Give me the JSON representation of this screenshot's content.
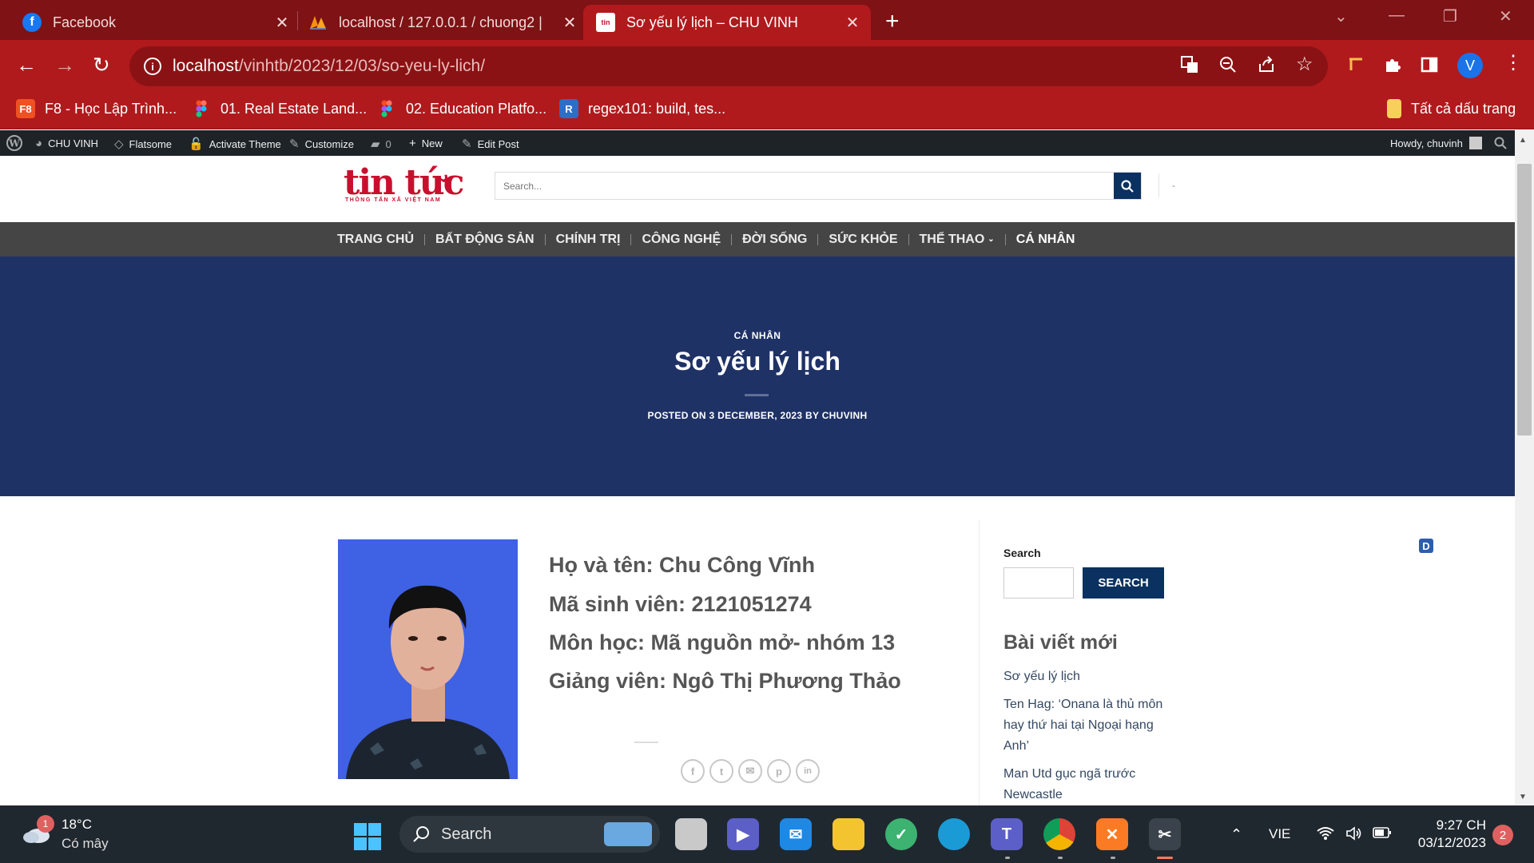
{
  "browser": {
    "tabs": [
      {
        "title": "Facebook",
        "active": false
      },
      {
        "title": "localhost / 127.0.0.1 / chuong2 |",
        "active": false
      },
      {
        "title": "Sơ yếu lý lịch – CHU VINH",
        "active": true
      }
    ],
    "new_tab_label": "+",
    "url_host": "localhost",
    "url_path": "/vinhtb/2023/12/03/so-yeu-ly-lich/",
    "profile_initial": "V",
    "bookmarks": [
      {
        "label": "F8 - Học Lập Trình...",
        "icon": "F8"
      },
      {
        "label": "01. Real Estate Land...",
        "icon": "figma-icon"
      },
      {
        "label": "02. Education Platfo...",
        "icon": "figma-icon"
      },
      {
        "label": "regex101: build, tes...",
        "icon": "R"
      }
    ],
    "all_bookmarks": "Tất cả dấu trang",
    "accent": "#b01a1d"
  },
  "adminbar": {
    "site": "CHU VINH",
    "theme": "Flatsome",
    "activate": "Activate Theme",
    "customize": "Customize",
    "comments": "0",
    "new": "New",
    "edit": "Edit Post",
    "howdy": "Howdy, chuvinh"
  },
  "site": {
    "logo": "tin tức",
    "logo_sub": "THÔNG TẤN XÃ VIỆT NAM",
    "search_placeholder": "Search...",
    "header_dash": "-",
    "nav": [
      "TRANG CHỦ",
      "BẤT ĐỘNG SẢN",
      "CHÍNH TRỊ",
      "CÔNG NGHỆ",
      "ĐỜI SỐNG",
      "SỨC KHỎE",
      "THỂ THAO",
      "CÁ NHÂN"
    ],
    "nav_dropdown_index": 6,
    "hero_bg": "#1f3266",
    "category": "CÁ NHÂN",
    "post_title": "Sơ yếu lý lịch",
    "meta": "POSTED ON 3 DECEMBER, 2023 BY CHUVINH",
    "info": [
      "Họ và tên: Chu Công Vĩnh",
      "Mã sinh viên: 2121051274",
      "Môn học: Mã nguồn mở- nhóm 13",
      "Giảng viên: Ngô Thị Phương Thảo"
    ],
    "share": [
      "f",
      "t",
      "✉",
      "p",
      "in"
    ],
    "sidebar": {
      "search_label": "Search",
      "search_button": "SEARCH",
      "recent_title": "Bài viết mới",
      "recent_posts": [
        "Sơ yếu lý lịch",
        "Ten Hag: ‘Onana là thủ môn hay thứ hai tại Ngoại hạng Anh’",
        "Man Utd gục ngã trước Newcastle"
      ]
    },
    "badge": "D"
  },
  "taskbar": {
    "temp": "18°C",
    "condition": "Có mây",
    "weather_badge": "1",
    "search": "Search",
    "lang": "VIE",
    "time": "9:27 CH",
    "date": "03/12/2023",
    "notifications": "2"
  }
}
